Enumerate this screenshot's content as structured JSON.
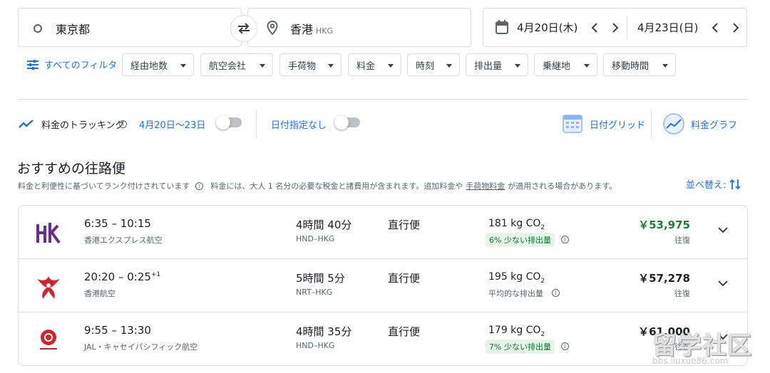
{
  "search": {
    "origin": "東京都",
    "destination": "香港",
    "destination_code": "HKG",
    "depart_date": "4月20日(木)",
    "return_date": "4月23日(日)"
  },
  "filters": {
    "all_filters": "すべてのフィルタ",
    "chips": [
      "経由地数",
      "航空会社",
      "手荷物",
      "料金",
      "時刻",
      "排出量",
      "乗継地",
      "移動時間"
    ]
  },
  "tracking": {
    "label": "料金のトラッキング",
    "range": "4月20日〜23日",
    "range_toggle_on": false,
    "flexible": "日付指定なし",
    "flexible_toggle_on": false,
    "date_grid": "日付グリッド",
    "price_graph": "料金グラフ"
  },
  "results": {
    "title": "おすすめの往路便",
    "subtitle_a": "料金と利便性に基づいてランク付けされています",
    "subtitle_b": "料金には、大人 1 名分の必要な税金と諸費用が含まれます。追加料金や",
    "subtitle_link": "手荷物料金",
    "subtitle_c": "が適用される場合があります。",
    "sort_label": "並べ替え:",
    "flights": [
      {
        "logo": "hk-express-logo",
        "time": "6:35 – 10:15",
        "day_offset": "",
        "airline": "香港エクスプレス航空",
        "duration": "4時間 40分",
        "route": "HND–HKG",
        "stops": "直行便",
        "co2": "181 kg CO",
        "emission_note": "6% 少ない排出量",
        "emission_badge": true,
        "price": "￥53,975",
        "price_highlight": true,
        "price_type": "往復"
      },
      {
        "logo": "cathay-logo",
        "time": "20:20 – 0:25",
        "day_offset": "+1",
        "airline": "香港航空",
        "duration": "5時間 5分",
        "route": "NRT–HKG",
        "stops": "直行便",
        "co2": "195 kg CO",
        "emission_note": "平均的な排出量",
        "emission_badge": false,
        "price": "￥57,278",
        "price_highlight": false,
        "price_type": "往復"
      },
      {
        "logo": "jal-logo",
        "time": "9:55 – 13:30",
        "day_offset": "",
        "airline": "JAL・キャセイパシフィック航空",
        "duration": "4時間 35分",
        "route": "HND–HKG",
        "stops": "直行便",
        "co2": "179 kg CO",
        "emission_note": "7% 少ない排出量",
        "emission_badge": true,
        "price": "￥61,000",
        "price_highlight": false,
        "price_type": "往復"
      }
    ]
  },
  "watermark": {
    "title": "留学社区",
    "url": "bbs.liuxue86.com"
  }
}
